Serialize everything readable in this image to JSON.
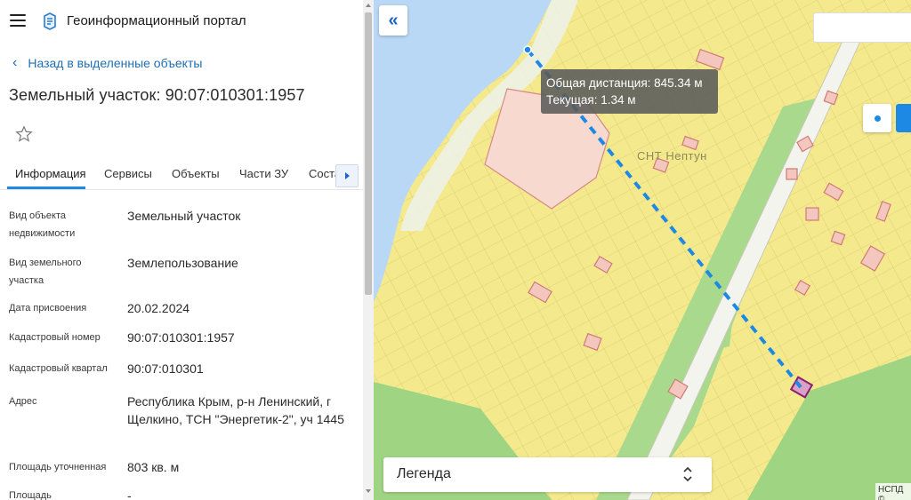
{
  "header": {
    "title": "Геоинформационный портал"
  },
  "back_link": {
    "label": "Назад в выделенные объекты"
  },
  "object": {
    "title": "Земельный участок: 90:07:010301:1957"
  },
  "tabs": [
    {
      "label": "Информация",
      "active": true
    },
    {
      "label": "Сервисы"
    },
    {
      "label": "Объекты"
    },
    {
      "label": "Части ЗУ"
    },
    {
      "label": "Соста"
    }
  ],
  "properties": [
    {
      "label": "Вид объекта недвижимости",
      "value": "Земельный участок"
    },
    {
      "label": "Вид земельного участка",
      "value": "Землепользование"
    },
    {
      "label": "Дата присвоения",
      "value": "20.02.2024"
    },
    {
      "label": "Кадастровый номер",
      "value": "90:07:010301:1957"
    },
    {
      "label": "Кадастровый квартал",
      "value": "90:07:010301"
    },
    {
      "label": "Адрес",
      "value": "Республика Крым, р-н Ленинский, г Щелкино, ТСН \"Энергетик-2\", уч 1445"
    },
    {
      "label": "Площадь уточненная",
      "value": "803 кв. м"
    },
    {
      "label": "Площадь",
      "value": "-"
    }
  ],
  "map": {
    "tooltip_total": "Общая дистанция: 845.34 м",
    "tooltip_current": "Текущая: 1.34 м",
    "area_label": "СНТ Нептун",
    "legend_label": "Легенда",
    "credit": "НСПД ©",
    "colors": {
      "land": "#f5e98e",
      "water": "#b9d8f5",
      "green": "#a9d98c",
      "measure": "#1e88e5"
    }
  }
}
